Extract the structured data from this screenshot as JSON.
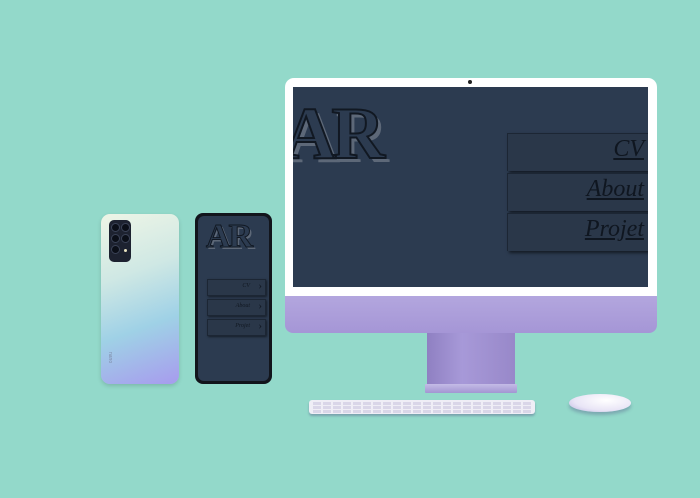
{
  "brand": {
    "logo_text": "AR",
    "back_phone_logo": "nano"
  },
  "desktop_menu": [
    {
      "label": "CV"
    },
    {
      "label": "About"
    },
    {
      "label": "Projet"
    }
  ],
  "mobile_menu": [
    {
      "label": "CV"
    },
    {
      "label": "About"
    },
    {
      "label": "Projet"
    }
  ],
  "colors": {
    "background": "#93d9ca",
    "screen": "#2c3b50",
    "imac_body": "#a596d6",
    "menu_text": "#0f1620"
  }
}
